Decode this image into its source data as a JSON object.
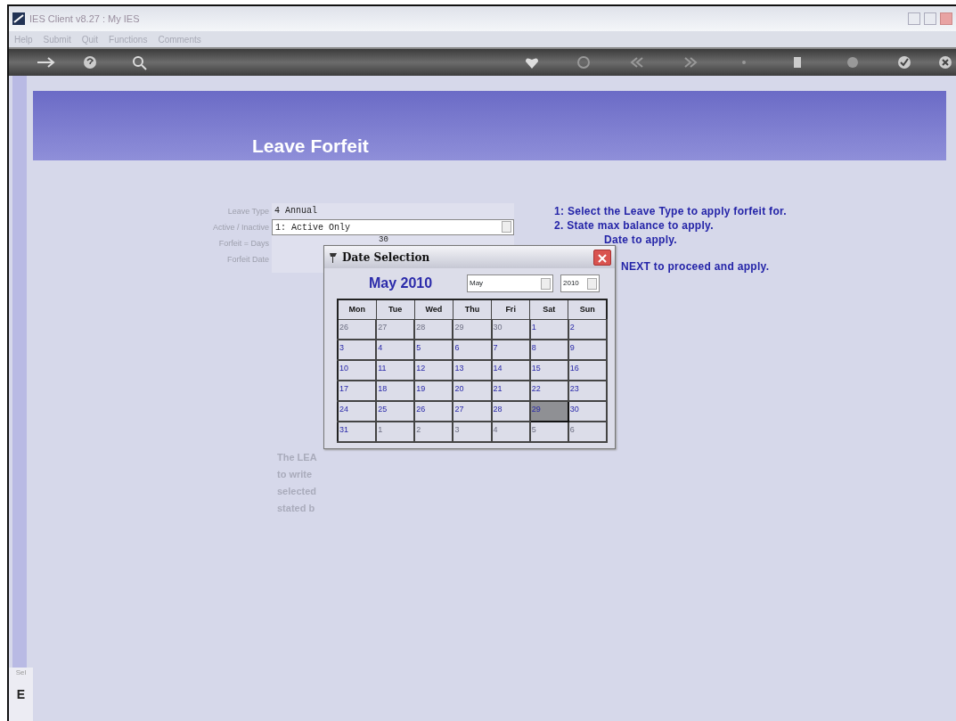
{
  "window": {
    "title": "IES Client v8.27 : My IES"
  },
  "menu": [
    "Help",
    "Submit",
    "Quit",
    "Functions",
    "Comments"
  ],
  "page_title": "Leave Forfeit",
  "form": [
    {
      "label": "Leave Type",
      "kind": "text",
      "value": "4 Annual"
    },
    {
      "label": "Active / Inactive",
      "kind": "select",
      "value": "1: Active Only"
    },
    {
      "label": "Forfeit = Days",
      "kind": "text",
      "value": "30"
    },
    {
      "label": "Forfeit Date",
      "kind": "text"
    }
  ],
  "instructions": [
    "1: Select the Leave Type to apply forfeit for.",
    "2. State max balance to apply.",
    "Date to apply.",
    "NEXT to proceed and apply."
  ],
  "note_lines": [
    "The LEA",
    "to write",
    "selected",
    "stated b"
  ],
  "side_label": "Sel",
  "side_button": "E",
  "dialog": {
    "title": "Date Selection",
    "heading": "May 2010",
    "month": "May",
    "year": "2010",
    "weekdays": [
      "Mon",
      "Tue",
      "Wed",
      "Thu",
      "Fri",
      "Sat",
      "Sun"
    ],
    "weeks": [
      [
        {
          "day": "26",
          "in_month": false,
          "selected": false
        },
        {
          "day": "27",
          "in_month": false,
          "selected": false
        },
        {
          "day": "28",
          "in_month": false,
          "selected": false
        },
        {
          "day": "29",
          "in_month": false,
          "selected": false
        },
        {
          "day": "30",
          "in_month": false,
          "selected": false
        },
        {
          "day": "1",
          "in_month": true,
          "selected": false
        },
        {
          "day": "2",
          "in_month": true,
          "selected": false
        }
      ],
      [
        {
          "day": "3",
          "in_month": true,
          "selected": false
        },
        {
          "day": "4",
          "in_month": true,
          "selected": false
        },
        {
          "day": "5",
          "in_month": true,
          "selected": false
        },
        {
          "day": "6",
          "in_month": true,
          "selected": false
        },
        {
          "day": "7",
          "in_month": true,
          "selected": false
        },
        {
          "day": "8",
          "in_month": true,
          "selected": false
        },
        {
          "day": "9",
          "in_month": true,
          "selected": false
        }
      ],
      [
        {
          "day": "10",
          "in_month": true,
          "selected": false
        },
        {
          "day": "11",
          "in_month": true,
          "selected": false
        },
        {
          "day": "12",
          "in_month": true,
          "selected": false
        },
        {
          "day": "13",
          "in_month": true,
          "selected": false
        },
        {
          "day": "14",
          "in_month": true,
          "selected": false
        },
        {
          "day": "15",
          "in_month": true,
          "selected": false
        },
        {
          "day": "16",
          "in_month": true,
          "selected": false
        }
      ],
      [
        {
          "day": "17",
          "in_month": true,
          "selected": false
        },
        {
          "day": "18",
          "in_month": true,
          "selected": false
        },
        {
          "day": "19",
          "in_month": true,
          "selected": false
        },
        {
          "day": "20",
          "in_month": true,
          "selected": false
        },
        {
          "day": "21",
          "in_month": true,
          "selected": false
        },
        {
          "day": "22",
          "in_month": true,
          "selected": false
        },
        {
          "day": "23",
          "in_month": true,
          "selected": false
        }
      ],
      [
        {
          "day": "24",
          "in_month": true,
          "selected": false
        },
        {
          "day": "25",
          "in_month": true,
          "selected": false
        },
        {
          "day": "26",
          "in_month": true,
          "selected": false
        },
        {
          "day": "27",
          "in_month": true,
          "selected": false
        },
        {
          "day": "28",
          "in_month": true,
          "selected": false
        },
        {
          "day": "29",
          "in_month": true,
          "selected": true
        },
        {
          "day": "30",
          "in_month": true,
          "selected": false
        }
      ],
      [
        {
          "day": "31",
          "in_month": true,
          "selected": false
        },
        {
          "day": "1",
          "in_month": false,
          "selected": false
        },
        {
          "day": "2",
          "in_month": false,
          "selected": false
        },
        {
          "day": "3",
          "in_month": false,
          "selected": false
        },
        {
          "day": "4",
          "in_month": false,
          "selected": false
        },
        {
          "day": "5",
          "in_month": false,
          "selected": false
        },
        {
          "day": "6",
          "in_month": false,
          "selected": false
        }
      ]
    ]
  }
}
